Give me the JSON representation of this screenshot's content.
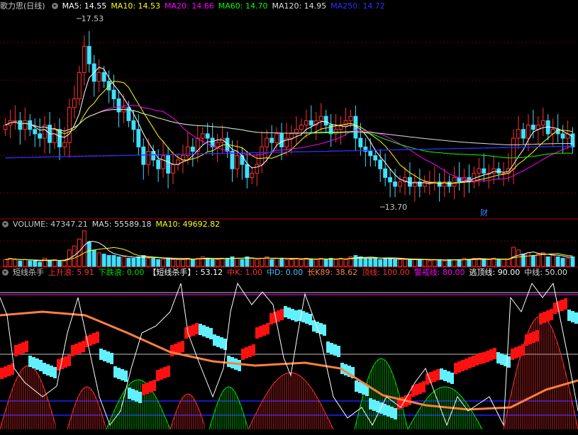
{
  "panels": {
    "price": {
      "title": "歌力思(日线)",
      "mas": [
        {
          "label": "MA5: 14.55",
          "color": "#ffffff"
        },
        {
          "label": "MA10: 14.53",
          "color": "#ffff00"
        },
        {
          "label": "MA20: 14.66",
          "color": "#ff00ff"
        },
        {
          "label": "MA60: 14.70",
          "color": "#00ff00"
        },
        {
          "label": "MA120: 14.95",
          "color": "#dddddd"
        },
        {
          "label": "MA250: 14.72",
          "color": "#3030ff"
        }
      ],
      "high_label": "17.53",
      "low_label": "13.70",
      "marker": "财"
    },
    "volume": {
      "title": "VOLUME: 47347.21",
      "ma5": "MA5: 55589.18",
      "ma10": "MA10: 49692.82"
    },
    "indicator": {
      "title": "短线杀手",
      "items": [
        {
          "label": "上升浪: 5.91",
          "color": "#ff3030"
        },
        {
          "label": "下跌浪: 0.00",
          "color": "#00e000"
        },
        {
          "label": "【短线杀手】: 53.12",
          "color": "#ffffff"
        },
        {
          "label": "中K: 1.00",
          "color": "#ff3030"
        },
        {
          "label": "中D: 0.00",
          "color": "#40c0ff"
        },
        {
          "label": "长K89: 38.62",
          "color": "#ff8040"
        },
        {
          "label": "顶线: 100.00",
          "color": "#ff3030"
        },
        {
          "label": "警戒线: 80.00",
          "color": "#ff00ff"
        },
        {
          "label": "逃顶线: 90.00",
          "color": "#ffffff"
        },
        {
          "label": "中线: 50.00",
          "color": "#dddddd"
        }
      ]
    }
  },
  "chart_data": [
    {
      "type": "candlestick",
      "name": "price",
      "ylim": [
        13.2,
        17.8
      ],
      "high": 17.53,
      "low": 13.7,
      "closes": [
        15.2,
        15.3,
        15.3,
        15.1,
        15.3,
        15.1,
        15.0,
        14.9,
        15.2,
        14.8,
        15.1,
        14.7,
        14.8,
        15.6,
        15.8,
        16.4,
        17.0,
        16.6,
        16.2,
        16.4,
        16.2,
        16.0,
        15.8,
        15.5,
        15.6,
        15.3,
        15.1,
        14.7,
        14.3,
        14.6,
        14.4,
        14.2,
        14.5,
        14.1,
        14.3,
        14.4,
        14.5,
        14.7,
        14.6,
        14.9,
        15.0,
        14.9,
        14.7,
        14.8,
        14.9,
        14.6,
        14.2,
        14.5,
        14.3,
        14.0,
        14.1,
        14.3,
        14.7,
        14.9,
        14.8,
        15.0,
        14.7,
        14.9,
        15.0,
        15.1,
        15.2,
        15.3,
        15.2,
        15.3,
        15.4,
        15.2,
        15.0,
        15.1,
        15.2,
        15.3,
        15.4,
        14.9,
        14.7,
        14.6,
        14.5,
        14.4,
        14.2,
        14.0,
        13.9,
        13.8,
        13.9,
        14.0,
        13.8,
        13.9,
        13.8,
        13.9,
        13.9,
        13.9,
        13.8,
        13.9,
        13.8,
        14.0,
        13.9,
        14.0,
        13.9,
        14.1,
        14.2,
        14.1,
        14.1,
        14.2,
        14.1,
        14.1,
        14.2,
        14.9,
        15.1,
        14.9,
        15.2,
        15.1,
        15.2,
        15.3,
        15.0,
        15.1,
        15.0,
        14.9,
        15.0,
        14.7
      ],
      "opens": [
        15.1,
        15.2,
        15.3,
        15.3,
        15.1,
        15.3,
        15.1,
        15.0,
        14.9,
        15.2,
        14.8,
        15.1,
        14.7,
        14.8,
        15.6,
        15.8,
        16.4,
        17.0,
        16.6,
        16.2,
        16.4,
        16.2,
        16.0,
        15.8,
        15.5,
        15.6,
        15.3,
        15.1,
        14.7,
        14.3,
        14.6,
        14.4,
        14.2,
        14.5,
        14.1,
        14.3,
        14.4,
        14.5,
        14.7,
        14.6,
        14.9,
        15.0,
        14.9,
        14.7,
        14.8,
        14.9,
        14.6,
        14.2,
        14.5,
        14.3,
        14.0,
        14.1,
        14.3,
        14.7,
        14.9,
        14.8,
        15.0,
        14.7,
        14.9,
        15.0,
        15.1,
        15.2,
        15.3,
        15.2,
        15.3,
        15.4,
        15.2,
        15.0,
        15.1,
        15.2,
        15.3,
        15.4,
        14.9,
        14.7,
        14.6,
        14.5,
        14.4,
        14.2,
        14.0,
        13.9,
        13.8,
        13.9,
        14.0,
        13.8,
        13.9,
        13.8,
        13.9,
        13.9,
        13.9,
        13.8,
        13.9,
        13.8,
        14.0,
        13.9,
        14.0,
        13.9,
        14.1,
        14.2,
        14.1,
        14.1,
        14.2,
        14.1,
        14.1,
        14.2,
        14.9,
        15.1,
        14.9,
        15.2,
        15.1,
        15.2,
        15.3,
        15.0,
        15.1,
        15.0,
        14.9,
        15.0
      ],
      "ma_lines": [
        "MA5",
        "MA10",
        "MA20",
        "MA60",
        "MA120",
        "MA250"
      ]
    },
    {
      "type": "bar",
      "name": "volume",
      "values": [
        5,
        6,
        5,
        4,
        5,
        4,
        4,
        3,
        6,
        4,
        5,
        4,
        4,
        12,
        15,
        20,
        26,
        18,
        12,
        10,
        9,
        8,
        8,
        7,
        7,
        6,
        6,
        7,
        8,
        6,
        6,
        5,
        5,
        6,
        5,
        5,
        5,
        6,
        5,
        6,
        7,
        6,
        5,
        5,
        6,
        6,
        7,
        6,
        5,
        7,
        6,
        5,
        6,
        7,
        5,
        6,
        6,
        5,
        5,
        6,
        5,
        6,
        5,
        5,
        6,
        5,
        6,
        5,
        6,
        5,
        7,
        8,
        7,
        6,
        6,
        6,
        5,
        6,
        6,
        5,
        5,
        5,
        5,
        5,
        5,
        5,
        4,
        5,
        5,
        4,
        5,
        5,
        5,
        6,
        5,
        6,
        6,
        5,
        5,
        6,
        5,
        5,
        5,
        14,
        12,
        9,
        10,
        8,
        9,
        10,
        7,
        8,
        7,
        6,
        6,
        7
      ]
    },
    {
      "type": "line",
      "name": "indicator",
      "ylim": [
        0,
        100
      ],
      "levels": {
        "顶线": 100,
        "警戒线": 80,
        "逃顶线": 90,
        "中线": 50
      }
    }
  ]
}
